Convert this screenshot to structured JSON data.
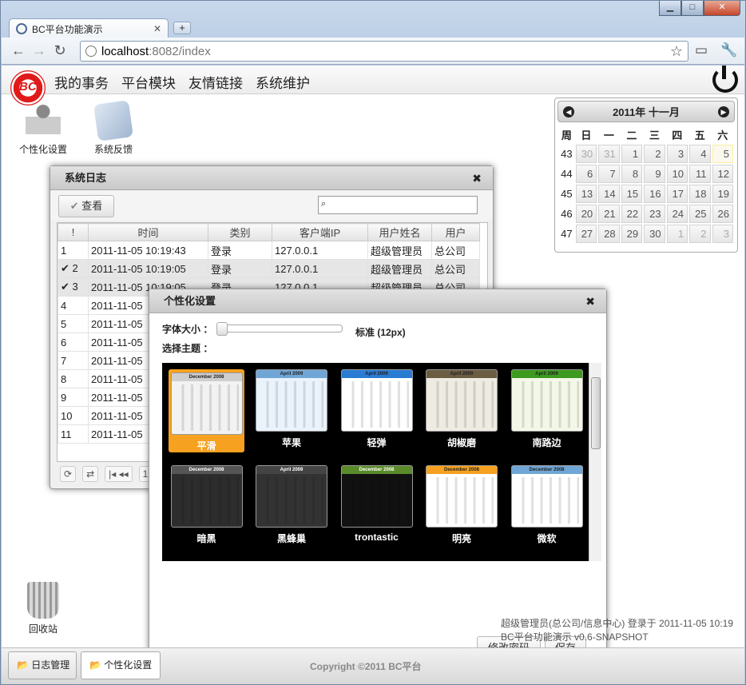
{
  "browser": {
    "tab_title": "BC平台功能演示",
    "new_tab": "+",
    "url_host": "localhost",
    "url_path": ":8082/index",
    "win_min": "▁",
    "win_max": "□",
    "win_close": "✕"
  },
  "nav": {
    "logo": "BC",
    "menu": [
      "我的事务",
      "平台模块",
      "友情链接",
      "系统维护"
    ]
  },
  "desktop": {
    "personal": "个性化设置",
    "feedback": "系统反馈",
    "recycle": "回收站"
  },
  "calendar": {
    "title": "2011年 十一月",
    "weekdays": [
      "周",
      "日",
      "一",
      "二",
      "三",
      "四",
      "五",
      "六"
    ],
    "weeks": [
      [
        "43",
        "30",
        "31",
        "1",
        "2",
        "3",
        "4",
        "5"
      ],
      [
        "44",
        "6",
        "7",
        "8",
        "9",
        "10",
        "11",
        "12"
      ],
      [
        "45",
        "13",
        "14",
        "15",
        "16",
        "17",
        "18",
        "19"
      ],
      [
        "46",
        "20",
        "21",
        "22",
        "23",
        "24",
        "25",
        "26"
      ],
      [
        "47",
        "27",
        "28",
        "29",
        "30",
        "1",
        "2",
        "3"
      ]
    ]
  },
  "log": {
    "title": "系统日志",
    "view_button": "查看",
    "columns": [
      "!",
      "时间",
      "类别",
      "客户端IP",
      "用户姓名",
      "用户"
    ],
    "rows": [
      [
        "1",
        "2011-11-05 10:19:43",
        "登录",
        "127.0.0.1",
        "超级管理员",
        "总公司"
      ],
      [
        "2",
        "2011-11-05 10:19:05",
        "登录",
        "127.0.0.1",
        "超级管理员",
        "总公司"
      ],
      [
        "3",
        "2011-11-05 10:19:05",
        "登录",
        "127.0.0.1",
        "超级管理员",
        "总公司"
      ],
      [
        "4",
        "2011-11-05",
        "",
        "",
        "",
        ""
      ],
      [
        "5",
        "2011-11-05",
        "",
        "",
        "",
        ""
      ],
      [
        "6",
        "2011-11-05",
        "",
        "",
        "",
        ""
      ],
      [
        "7",
        "2011-11-05",
        "",
        "",
        "",
        ""
      ],
      [
        "8",
        "2011-11-05",
        "",
        "",
        "",
        ""
      ],
      [
        "9",
        "2011-11-05",
        "",
        "",
        "",
        ""
      ],
      [
        "10",
        "2011-11-05",
        "",
        "",
        "",
        ""
      ],
      [
        "11",
        "2011-11-05",
        "",
        "",
        "",
        ""
      ]
    ],
    "pager_page": "1"
  },
  "personal": {
    "title": "个性化设置",
    "font_label": "字体大小 ：",
    "font_value": "标准 (12px)",
    "font_level": 0,
    "theme_label": "选择主题 ：",
    "themes": [
      "平滑",
      "苹果",
      "轻弹",
      "胡椒磨",
      "南路边",
      "暗黑",
      "黑蜂巢",
      "trontastic",
      "明亮",
      "微软"
    ],
    "theme_headers": [
      "December 2008",
      "April 2009",
      "April 2009",
      "April 2009",
      "April 2009",
      "December 2008",
      "April 2009",
      "December 2008",
      "December 2008",
      "December 2008"
    ],
    "change_pwd": "修改密码",
    "save": "保存"
  },
  "footer": {
    "login_info": "超级管理员(总公司/信息中心) 登录于 2011-11-05 10:19",
    "version": "BC平台功能演示 v0.6-SNAPSHOT",
    "copyright": "Copyright ©2011 BC平台"
  },
  "taskbar": [
    "日志管理",
    "个性化设置"
  ],
  "colors": {
    "selected_theme": "#f6a11f",
    "logo_red": "#e01a1a"
  }
}
